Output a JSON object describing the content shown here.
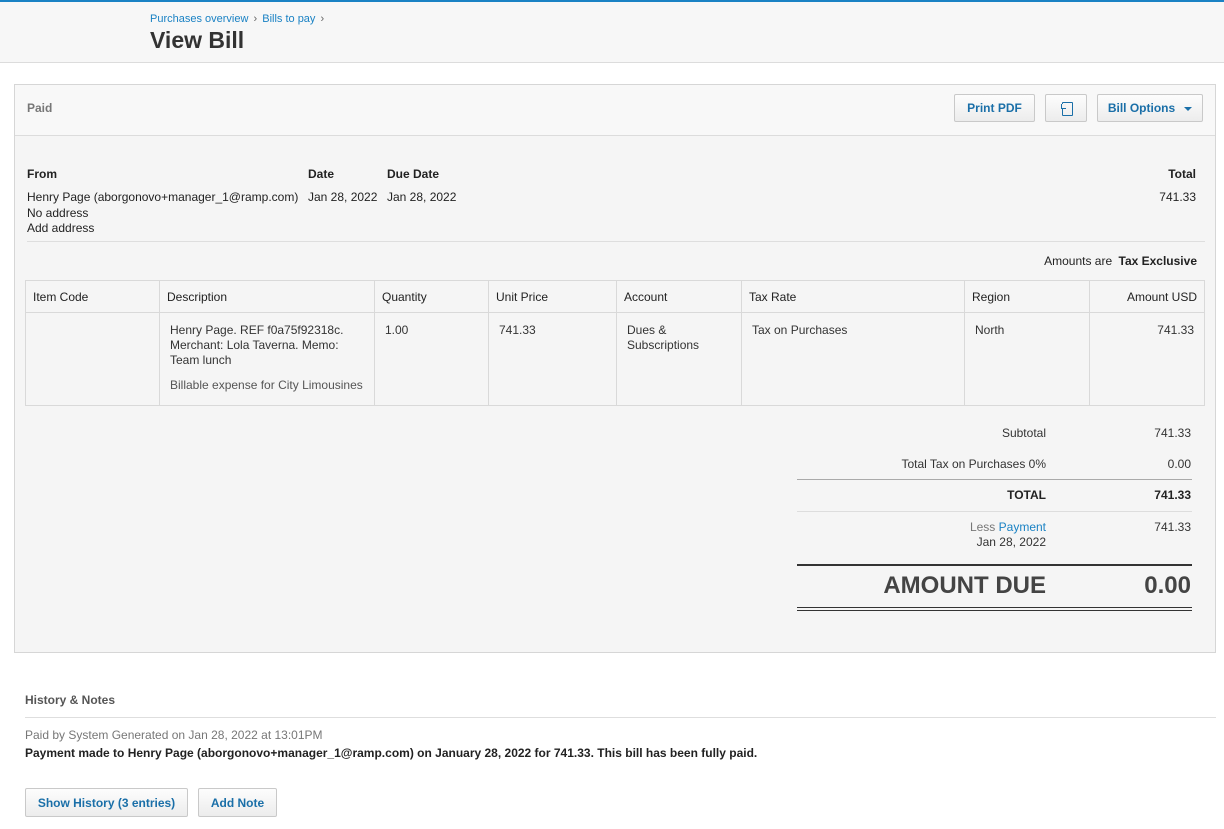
{
  "breadcrumb": {
    "items": [
      "Purchases overview",
      "Bills to pay"
    ],
    "separator": "›"
  },
  "page_title": "View Bill",
  "bill": {
    "status": "Paid",
    "toolbar": {
      "print_label": "Print PDF",
      "copy_icon": "copy-icon",
      "options_label": "Bill Options"
    },
    "headers": {
      "from": "From",
      "date": "Date",
      "due_date": "Due Date",
      "total": "Total"
    },
    "from_name": "Henry Page (aborgonovo+manager_1@ramp.com)",
    "no_address": "No address",
    "add_address": "Add address",
    "date": "Jan 28, 2022",
    "due_date": "Jan 28, 2022",
    "total": "741.33",
    "amounts_are_label": "Amounts are",
    "amounts_are_value": "Tax Exclusive"
  },
  "table": {
    "columns": [
      "Item Code",
      "Description",
      "Quantity",
      "Unit Price",
      "Account",
      "Tax Rate",
      "Region",
      "Amount USD"
    ],
    "rows": [
      {
        "item_code": "",
        "description": "Henry Page. REF f0a75f92318c. Merchant: Lola Taverna. Memo: Team lunch",
        "description_note": "Billable expense for City Limousines",
        "quantity": "1.00",
        "unit_price": "741.33",
        "account": "Dues & Subscriptions",
        "tax_rate": "Tax on Purchases",
        "region": "North",
        "amount": "741.33"
      }
    ]
  },
  "totals": {
    "subtotal_label": "Subtotal",
    "subtotal": "741.33",
    "tax_label": "Total Tax on Purchases 0%",
    "tax": "0.00",
    "total_label": "TOTAL",
    "total": "741.33",
    "less_label": "Less",
    "payment_link": "Payment",
    "payment_date": "Jan 28, 2022",
    "payment_amount": "741.33",
    "amount_due_label": "AMOUNT DUE",
    "amount_due": "0.00"
  },
  "history": {
    "title": "History & Notes",
    "meta": "Paid by System Generated on Jan 28, 2022 at 13:01PM",
    "text": "Payment made to Henry Page (aborgonovo+manager_1@ramp.com) on January 28, 2022 for 741.33. This bill has been fully paid.",
    "show_history_label": "Show History (3 entries)",
    "add_note_label": "Add Note"
  },
  "colors": {
    "accent": "#1a82c4",
    "panel_bg": "#f5f5f5",
    "border": "#d6d6d6"
  }
}
